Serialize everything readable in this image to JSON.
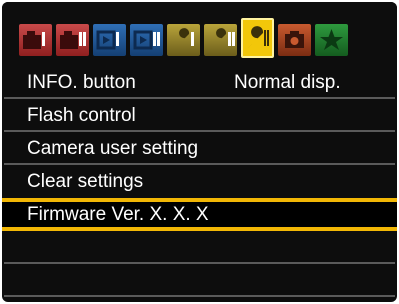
{
  "tabs": [
    {
      "icon": "shooting-menu-1-icon",
      "active": false
    },
    {
      "icon": "shooting-menu-2-icon",
      "active": false
    },
    {
      "icon": "playback-menu-1-icon",
      "active": false
    },
    {
      "icon": "playback-menu-2-icon",
      "active": false
    },
    {
      "icon": "setup-menu-1-icon",
      "active": false
    },
    {
      "icon": "setup-menu-2-icon",
      "active": false
    },
    {
      "icon": "setup-menu-3-icon",
      "active": true
    },
    {
      "icon": "custom-functions-icon",
      "active": false
    },
    {
      "icon": "my-menu-icon",
      "active": false
    }
  ],
  "menu": {
    "items": [
      {
        "label": "INFO. button",
        "value": "Normal disp."
      },
      {
        "label": "Flash control",
        "value": ""
      },
      {
        "label": "Camera user setting",
        "value": ""
      },
      {
        "label": "Clear settings",
        "value": ""
      },
      {
        "label": "Firmware Ver. X. X. X",
        "value": "",
        "selected": true
      }
    ]
  },
  "colors": {
    "highlight": "#f2b705",
    "active_tab": "#f2c70a",
    "background": "#0d0d0d",
    "text": "#ffffff"
  }
}
